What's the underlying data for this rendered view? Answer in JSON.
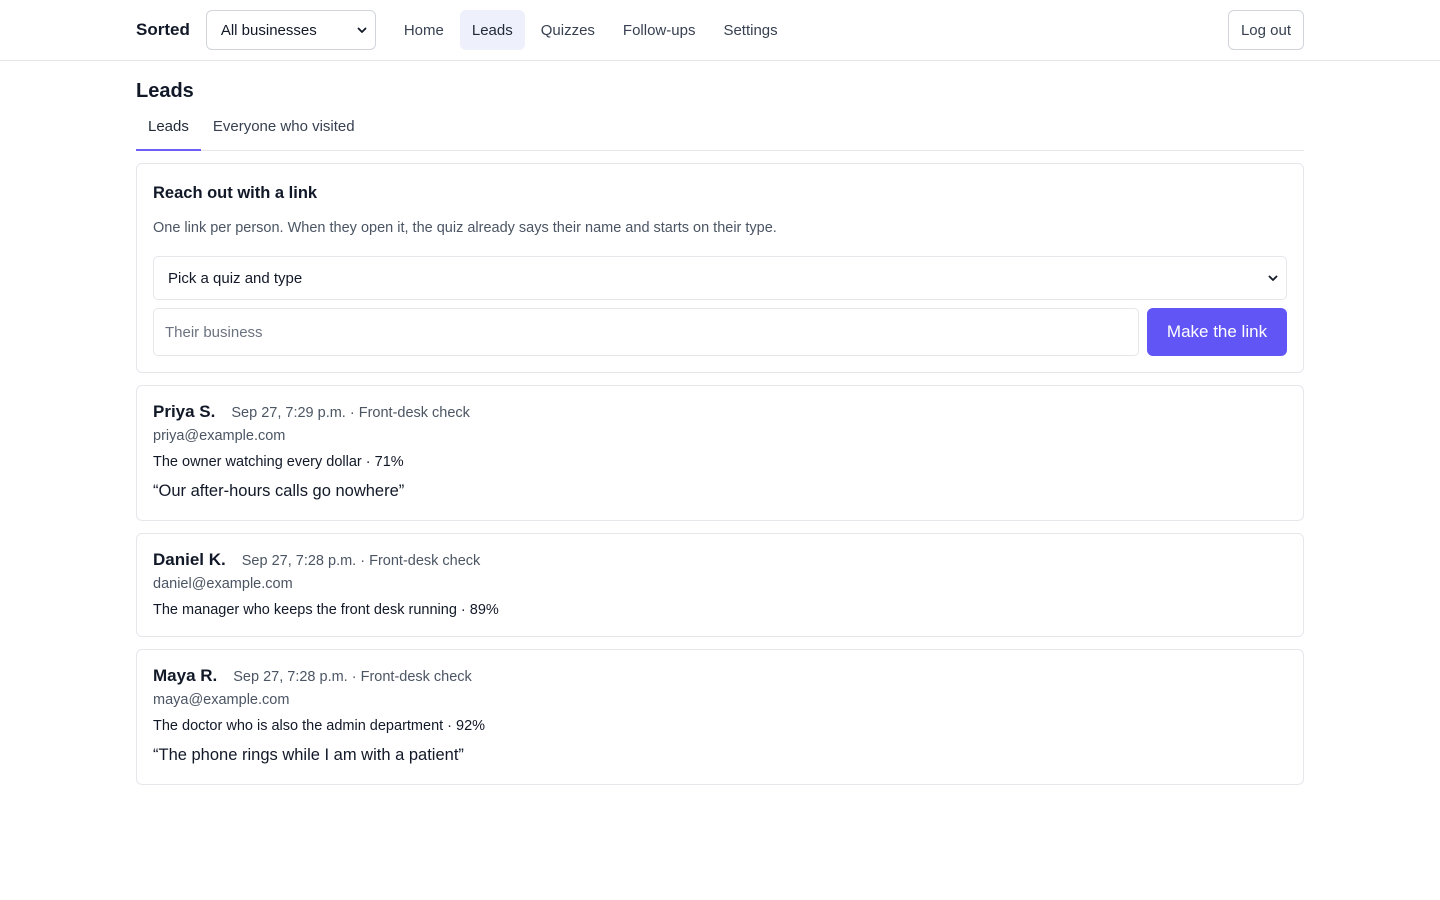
{
  "header": {
    "brand": "Sorted",
    "business_select": "All businesses",
    "nav": [
      {
        "label": "Home",
        "active": false
      },
      {
        "label": "Leads",
        "active": true
      },
      {
        "label": "Quizzes",
        "active": false
      },
      {
        "label": "Follow-ups",
        "active": false
      },
      {
        "label": "Settings",
        "active": false
      }
    ],
    "logout": "Log out"
  },
  "page": {
    "title": "Leads",
    "tabs": [
      {
        "label": "Leads",
        "active": true
      },
      {
        "label": "Everyone who visited",
        "active": false
      }
    ]
  },
  "reach": {
    "title": "Reach out with a link",
    "description": "One link per person. When they open it, the quiz already says their name and starts on their type.",
    "quiz_select": "Pick a quiz and type",
    "business_placeholder": "Their business",
    "button": "Make the link"
  },
  "leads": [
    {
      "name": "Priya S.",
      "meta": "Sep 27, 7:29 p.m. · Front-desk check",
      "email": "priya@example.com",
      "type": "The owner watching every dollar · 71%",
      "quote": "“Our after-hours calls go nowhere”"
    },
    {
      "name": "Daniel K.",
      "meta": "Sep 27, 7:28 p.m. · Front-desk check",
      "email": "daniel@example.com",
      "type": "The manager who keeps the front desk running · 89%",
      "quote": ""
    },
    {
      "name": "Maya R.",
      "meta": "Sep 27, 7:28 p.m. · Front-desk check",
      "email": "maya@example.com",
      "type": "The doctor who is also the admin department · 92%",
      "quote": "“The phone rings while I am with a patient”"
    }
  ],
  "colors": {
    "accent": "#6155f5",
    "nav_active_bg": "#eef0fb",
    "border": "#e5e7eb"
  }
}
